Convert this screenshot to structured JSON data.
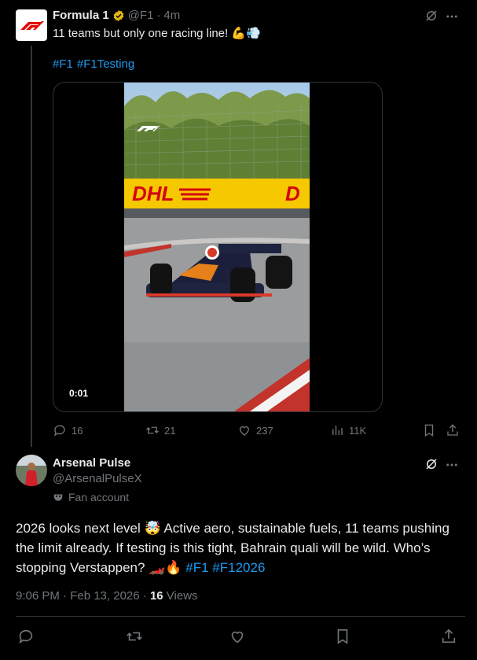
{
  "tweet1": {
    "author_name": "Formula 1",
    "handle": "@F1",
    "separator": "·",
    "time_ago": "4m",
    "text": "11 teams but only one racing line! 💪💨",
    "hashtags": [
      "#F1",
      "#F1Testing"
    ],
    "video_time": "0:01",
    "stats": {
      "replies": "16",
      "reposts": "21",
      "likes": "237",
      "views": "11K"
    }
  },
  "tweet2": {
    "author_name": "Arsenal Pulse",
    "handle": "@ArsenalPulseX",
    "badge_label": "Fan account",
    "text_main": "2026 looks next level 🤯 Active aero, sustainable fuels, 11 teams pushing the limit already. If testing is this tight, Bahrain quali will be wild. Who’s stopping Verstappen? 🏎️🔥 ",
    "hashtags": [
      "#F1",
      "#F12026"
    ],
    "time": "9:06 PM · Feb 13, 2026 · ",
    "views_count": "16",
    "views_label": " Views"
  },
  "colors": {
    "accent": "#1d9bf0",
    "muted": "#71767b",
    "text": "#e7e9ea",
    "verified": "#e2b719"
  },
  "icons": [
    "f1-logo-icon",
    "verified-badge-icon",
    "grok-icon",
    "more-icon",
    "reply-icon",
    "repost-icon",
    "like-icon",
    "views-icon",
    "bookmark-icon",
    "share-icon",
    "mask-icon"
  ]
}
